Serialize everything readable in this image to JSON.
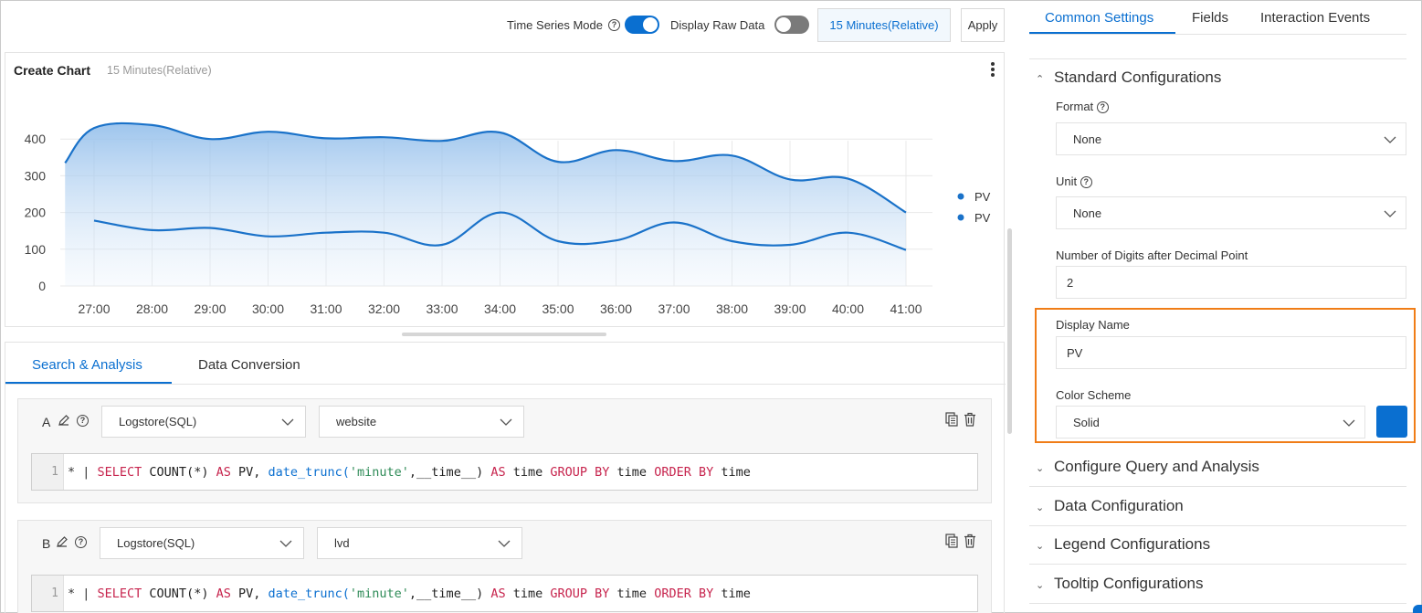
{
  "toolbar": {
    "time_series_label": "Time Series Mode",
    "time_series_on": true,
    "raw_data_label": "Display Raw Data",
    "raw_data_on": false,
    "time_range": "15 Minutes(Relative)",
    "apply_label": "Apply"
  },
  "chart": {
    "title": "Create Chart",
    "subtitle": "15 Minutes(Relative)"
  },
  "chart_data": {
    "type": "area",
    "categories": [
      "27:00",
      "28:00",
      "29:00",
      "30:00",
      "31:00",
      "32:00",
      "33:00",
      "34:00",
      "35:00",
      "36:00",
      "37:00",
      "38:00",
      "39:00",
      "40:00",
      "41:00"
    ],
    "y_ticks": [
      0,
      100,
      200,
      300,
      400
    ],
    "ylim": [
      0,
      420
    ],
    "legend_position": "right",
    "legend_color": "#1a72c9",
    "series": [
      {
        "name": "PV",
        "fill": true,
        "x": [
          "26:30",
          "27:00",
          "28:00",
          "29:00",
          "30:00",
          "31:00",
          "32:00",
          "33:00",
          "34:00",
          "35:00",
          "36:00",
          "37:00",
          "38:00",
          "39:00",
          "40:00",
          "41:00"
        ],
        "values": [
          335,
          430,
          438,
          400,
          420,
          402,
          405,
          395,
          418,
          338,
          370,
          340,
          355,
          290,
          292,
          200
        ]
      },
      {
        "name": "PV",
        "fill": false,
        "x": [
          "27:00",
          "28:00",
          "29:00",
          "30:00",
          "31:00",
          "32:00",
          "33:00",
          "34:00",
          "35:00",
          "36:00",
          "37:00",
          "38:00",
          "39:00",
          "40:00",
          "41:00"
        ],
        "values": [
          178,
          152,
          158,
          135,
          145,
          145,
          112,
          200,
          122,
          124,
          173,
          122,
          112,
          145,
          98
        ]
      }
    ]
  },
  "query_tabs": [
    "Search & Analysis",
    "Data Conversion"
  ],
  "queries": [
    {
      "letter": "A",
      "source": "Logstore(SQL)",
      "logstore": "website",
      "line_no": "1",
      "code": {
        "prefix": "* | ",
        "k1": "SELECT",
        "t1": " COUNT(*) ",
        "k2": "AS",
        "t2": " PV, ",
        "f1": "date_trunc(",
        "s1": "'minute'",
        "t3": ",__time__) ",
        "k3": "AS",
        "t4": " time ",
        "k4": "GROUP BY",
        "t5": " time ",
        "k5": "ORDER BY",
        "t6": " time"
      }
    },
    {
      "letter": "B",
      "source": "Logstore(SQL)",
      "logstore": "lvd",
      "line_no": "1",
      "code": {
        "prefix": "* | ",
        "k1": "SELECT",
        "t1": " COUNT(*) ",
        "k2": "AS",
        "t2": " PV, ",
        "f1": "date_trunc(",
        "s1": "'minute'",
        "t3": ",__time__) ",
        "k3": "AS",
        "t4": " time ",
        "k4": "GROUP BY",
        "t5": " time ",
        "k5": "ORDER BY",
        "t6": " time"
      }
    }
  ],
  "right_tabs": [
    "Common Settings",
    "Fields",
    "Interaction Events"
  ],
  "standard": {
    "heading": "Standard Configurations",
    "format_label": "Format",
    "format_value": "None",
    "unit_label": "Unit",
    "unit_value": "None",
    "digits_label": "Number of Digits after Decimal Point",
    "digits_value": "2",
    "display_name_label": "Display Name",
    "display_name_value": "PV",
    "color_scheme_label": "Color Scheme",
    "color_scheme_value": "Solid",
    "color_swatch": "#0a6fd0"
  },
  "sections": [
    "Configure Query and Analysis",
    "Data Configuration",
    "Legend Configurations",
    "Tooltip Configurations"
  ]
}
